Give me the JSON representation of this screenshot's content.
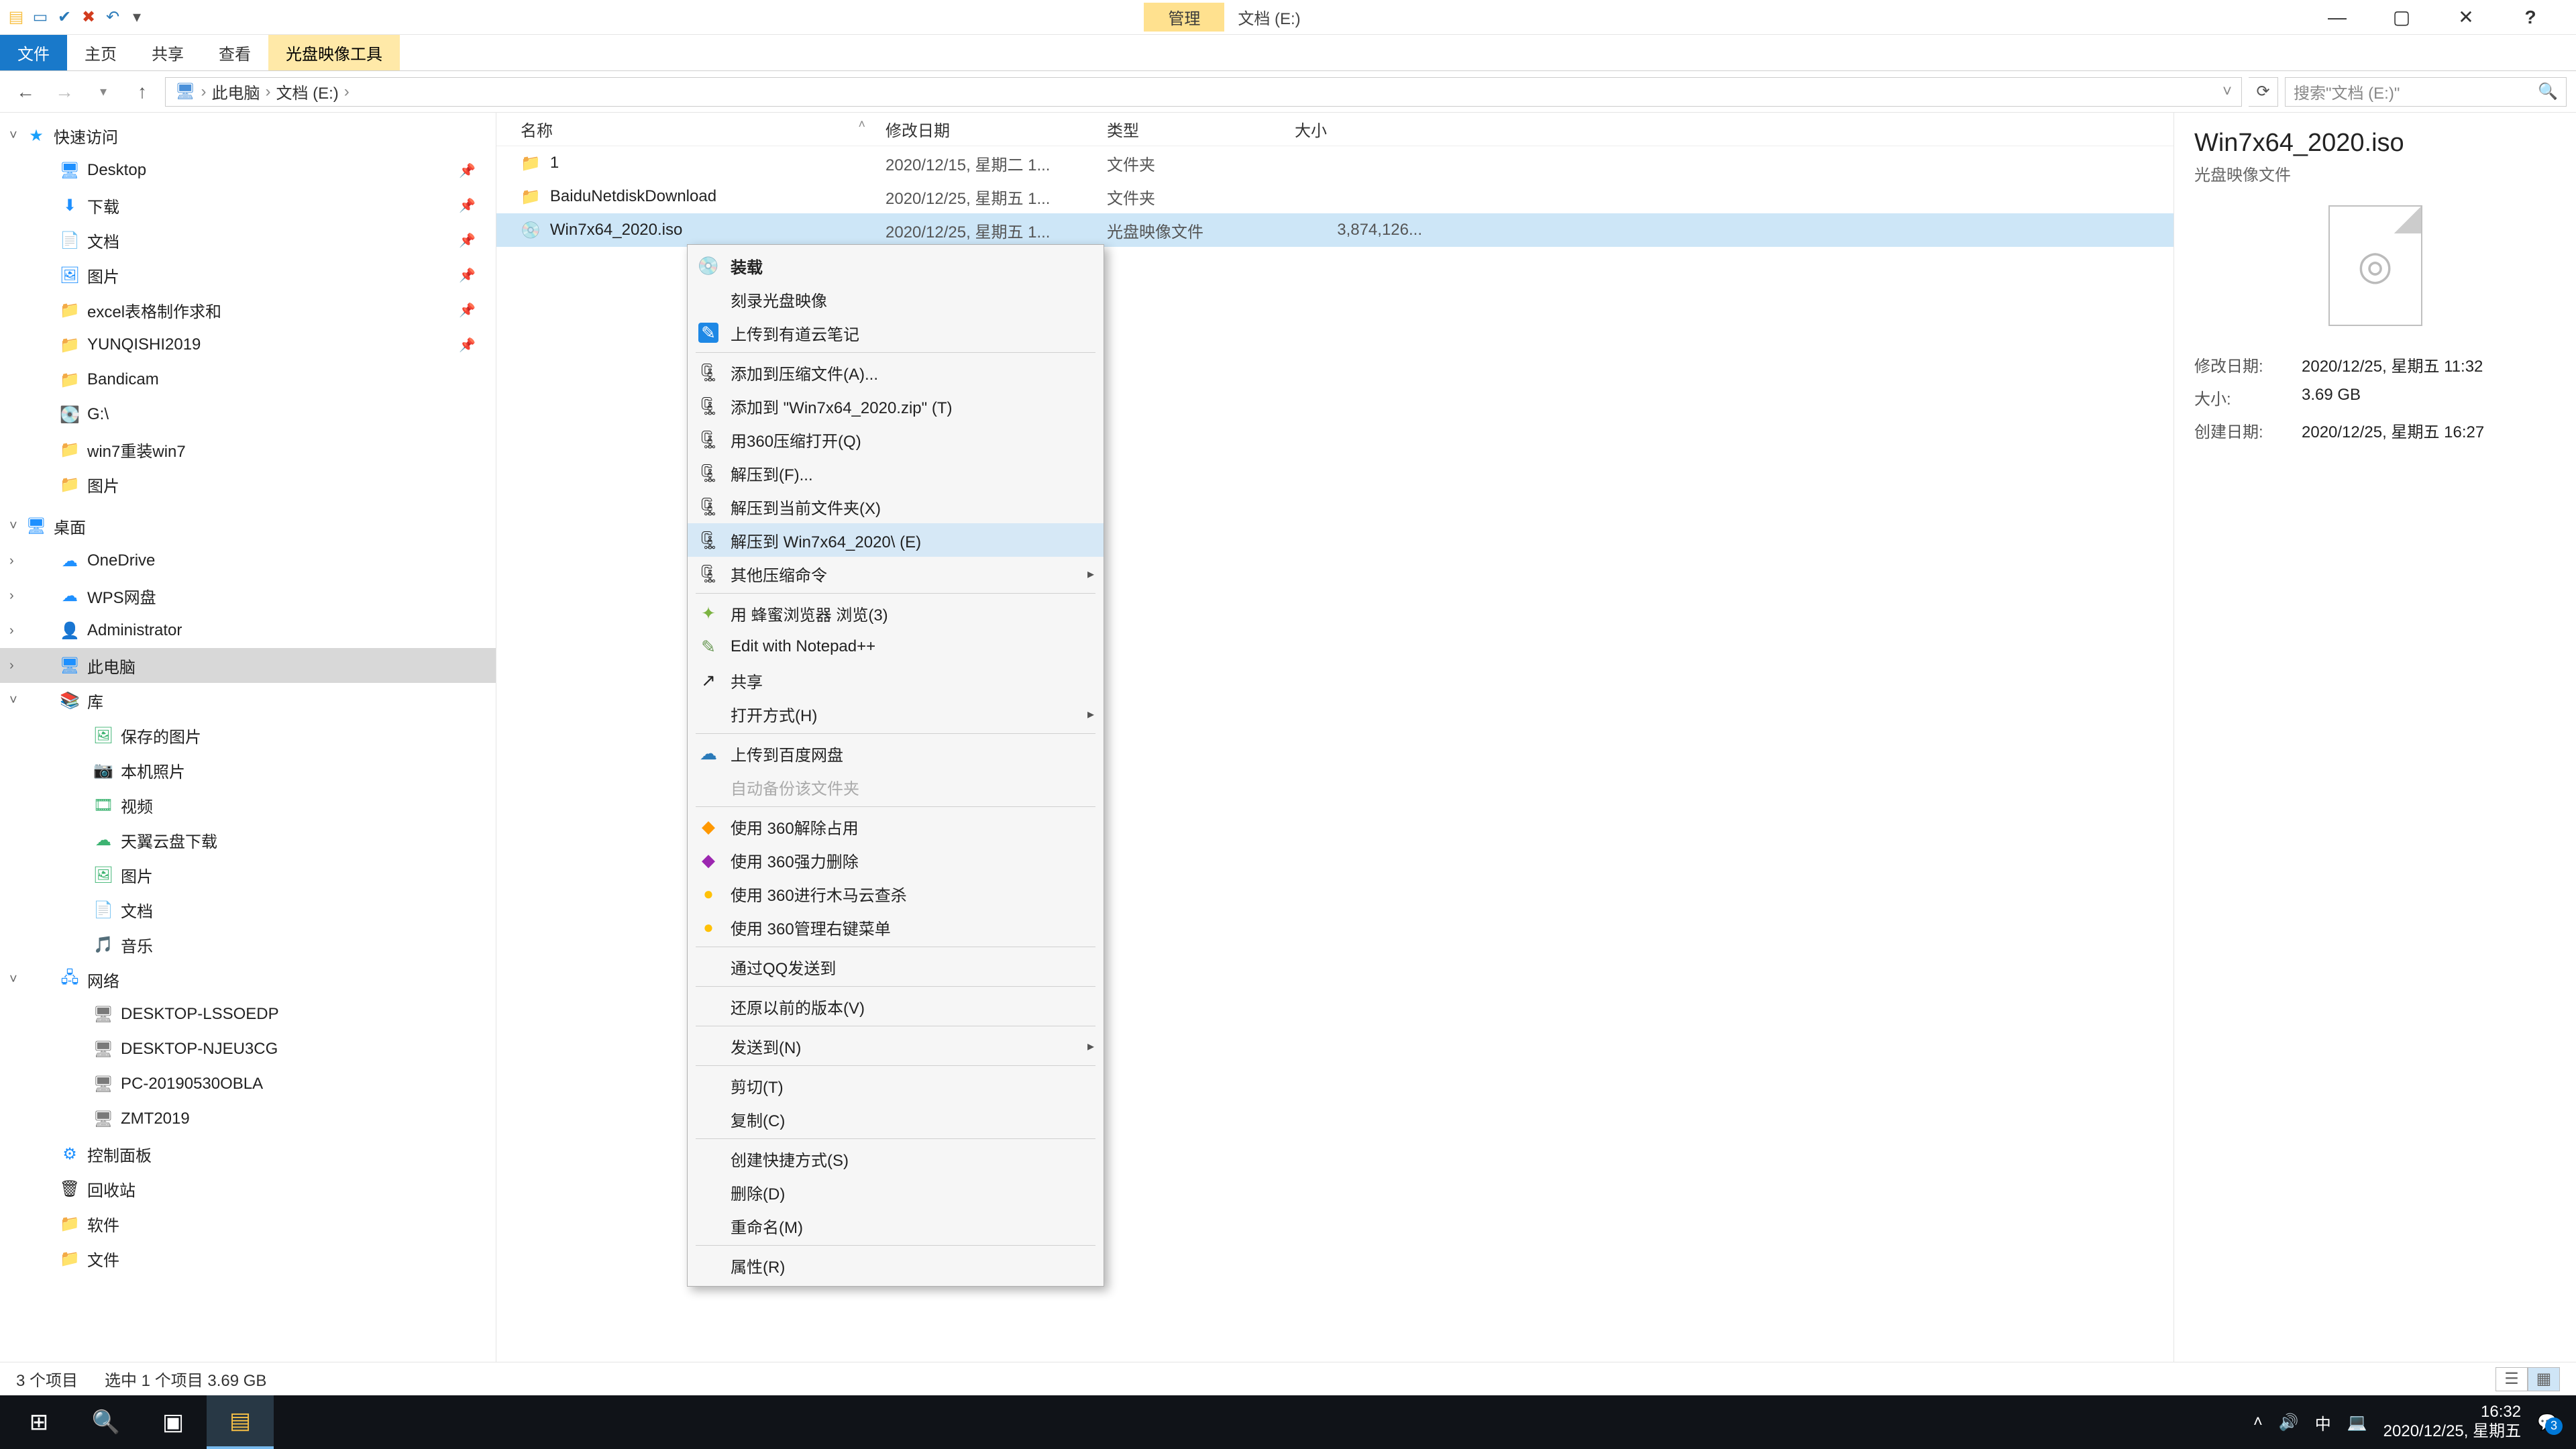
{
  "title": {
    "manage": "管理",
    "drive": "文档 (E:)"
  },
  "ribbon": {
    "file": "文件",
    "home": "主页",
    "share": "共享",
    "view": "查看",
    "disc_tool": "光盘映像工具"
  },
  "nav": {
    "this_pc": "此电脑",
    "drive": "文档 (E:)"
  },
  "search": {
    "placeholder": "搜索\"文档 (E:)\""
  },
  "tree": {
    "quick": "快速访问",
    "quick_items": [
      "Desktop",
      "下载",
      "文档",
      "图片",
      "excel表格制作求和",
      "YUNQISHI2019",
      "Bandicam",
      "G:\\",
      "win7重装win7",
      "图片"
    ],
    "desktop": "桌面",
    "desktop_items": [
      "OneDrive",
      "WPS网盘",
      "Administrator",
      "此电脑",
      "库"
    ],
    "lib_items": [
      "保存的图片",
      "本机照片",
      "视频",
      "天翼云盘下载",
      "图片",
      "文档",
      "音乐"
    ],
    "network": "网络",
    "net_items": [
      "DESKTOP-LSSOEDP",
      "DESKTOP-NJEU3CG",
      "PC-20190530OBLA",
      "ZMT2019"
    ],
    "extra": [
      "控制面板",
      "回收站",
      "软件",
      "文件"
    ]
  },
  "cols": {
    "name": "名称",
    "date": "修改日期",
    "type": "类型",
    "size": "大小"
  },
  "rows": [
    {
      "name": "1",
      "date": "2020/12/15, 星期二 1...",
      "type": "文件夹",
      "size": ""
    },
    {
      "name": "BaiduNetdiskDownload",
      "date": "2020/12/25, 星期五 1...",
      "type": "文件夹",
      "size": ""
    },
    {
      "name": "Win7x64_2020.iso",
      "date": "2020/12/25, 星期五 1...",
      "type": "光盘映像文件",
      "size": "3,874,126..."
    }
  ],
  "ctx": {
    "mount": "装载",
    "burn": "刻录光盘映像",
    "upload_youdao": "上传到有道云笔记",
    "add_archive": "添加到压缩文件(A)...",
    "add_zip": "添加到 \"Win7x64_2020.zip\" (T)",
    "open_360zip": "用360压缩打开(Q)",
    "extract_to": "解压到(F)...",
    "extract_here": "解压到当前文件夹(X)",
    "extract_folder": "解压到 Win7x64_2020\\ (E)",
    "other_zip": "其他压缩命令",
    "honey_browser": "用 蜂蜜浏览器 浏览(3)",
    "notepadpp": "Edit with Notepad++",
    "share": "共享",
    "open_with": "打开方式(H)",
    "upload_baidu": "上传到百度网盘",
    "auto_backup": "自动备份该文件夹",
    "u360_release": "使用 360解除占用",
    "u360_force_del": "使用 360强力删除",
    "u360_trojan": "使用 360进行木马云查杀",
    "u360_menu": "使用 360管理右键菜单",
    "qq_send": "通过QQ发送到",
    "restore_prev": "还原以前的版本(V)",
    "send_to": "发送到(N)",
    "cut": "剪切(T)",
    "copy": "复制(C)",
    "create_shortcut": "创建快捷方式(S)",
    "delete": "删除(D)",
    "rename": "重命名(M)",
    "properties": "属性(R)"
  },
  "details": {
    "name": "Win7x64_2020.iso",
    "type": "光盘映像文件",
    "mdate_k": "修改日期:",
    "mdate_v": "2020/12/25, 星期五 11:32",
    "size_k": "大小:",
    "size_v": "3.69 GB",
    "cdate_k": "创建日期:",
    "cdate_v": "2020/12/25, 星期五 16:27"
  },
  "status": {
    "count": "3 个项目",
    "selection": "选中 1 个项目  3.69 GB"
  },
  "taskbar": {
    "ime": "中",
    "time": "16:32",
    "date": "2020/12/25, 星期五",
    "badge": "3"
  }
}
